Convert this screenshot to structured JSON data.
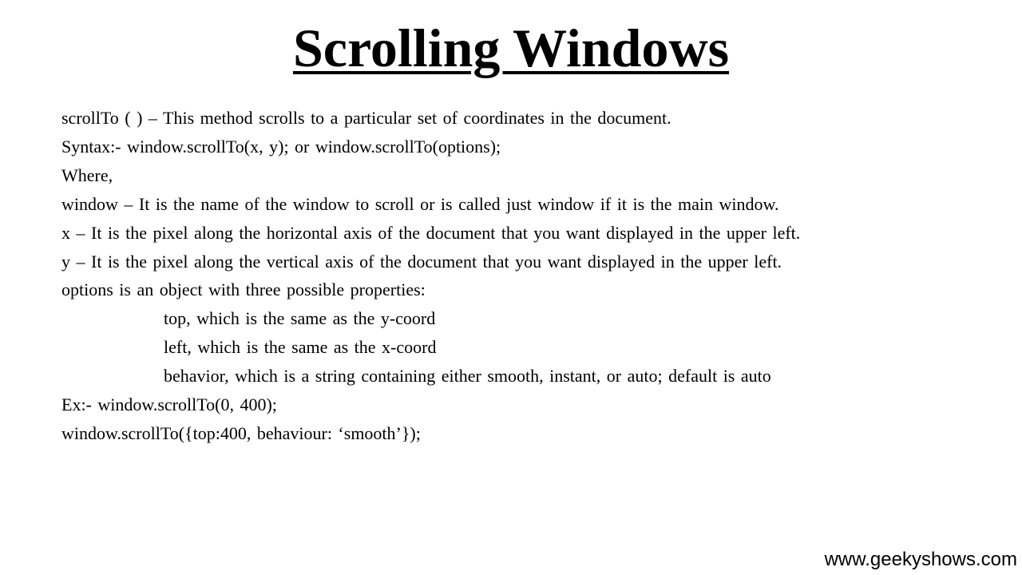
{
  "slide": {
    "title": "Scrolling Windows",
    "lines": [
      "scrollTo ( ) – This method scrolls to a particular set of coordinates in the document.",
      "Syntax:- window.scrollTo(x, y); or window.scrollTo(options);",
      "Where,",
      "window – It is the name of the window to scroll or is called just window if it is the main window.",
      "x – It is the pixel along the horizontal axis of the document that you want displayed in the upper left.",
      "y – It is the pixel along the vertical axis of the document that you want displayed in the upper left.",
      "options is an object with three possible properties:",
      "top, which is the same as the y-coord",
      "left, which is the same as the x-coord",
      "behavior, which is a string containing either smooth, instant, or auto; default is auto",
      "Ex:- window.scrollTo(0, 400);",
      "window.scrollTo({top:400, behaviour: ‘smooth’});"
    ],
    "footer_url": "www.geekyshows.com"
  }
}
